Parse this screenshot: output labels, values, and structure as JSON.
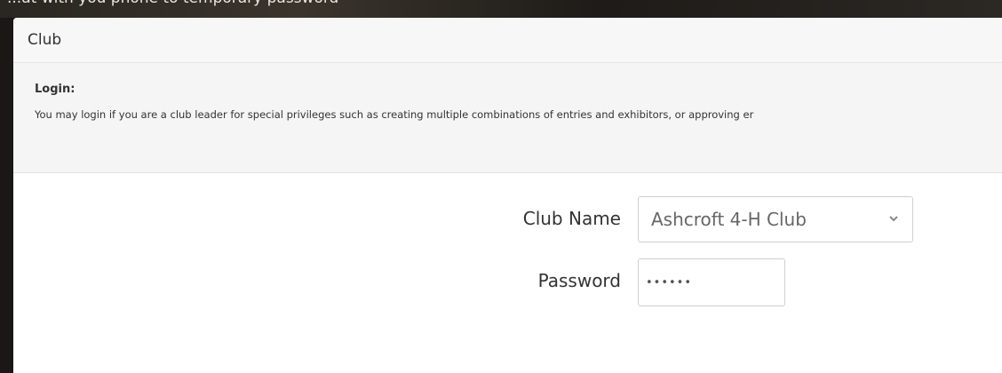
{
  "background": {
    "text": "...at with you phone to temporary password"
  },
  "modal": {
    "title": "Club",
    "info": {
      "heading": "Login:",
      "text": "You may login if you are a club leader for special privileges such as creating multiple combinations of entries and exhibitors, or approving er"
    },
    "form": {
      "club_name_label": "Club Name",
      "club_name_value": "Ashcroft 4-H Club",
      "password_label": "Password",
      "password_value": "••••••"
    }
  }
}
